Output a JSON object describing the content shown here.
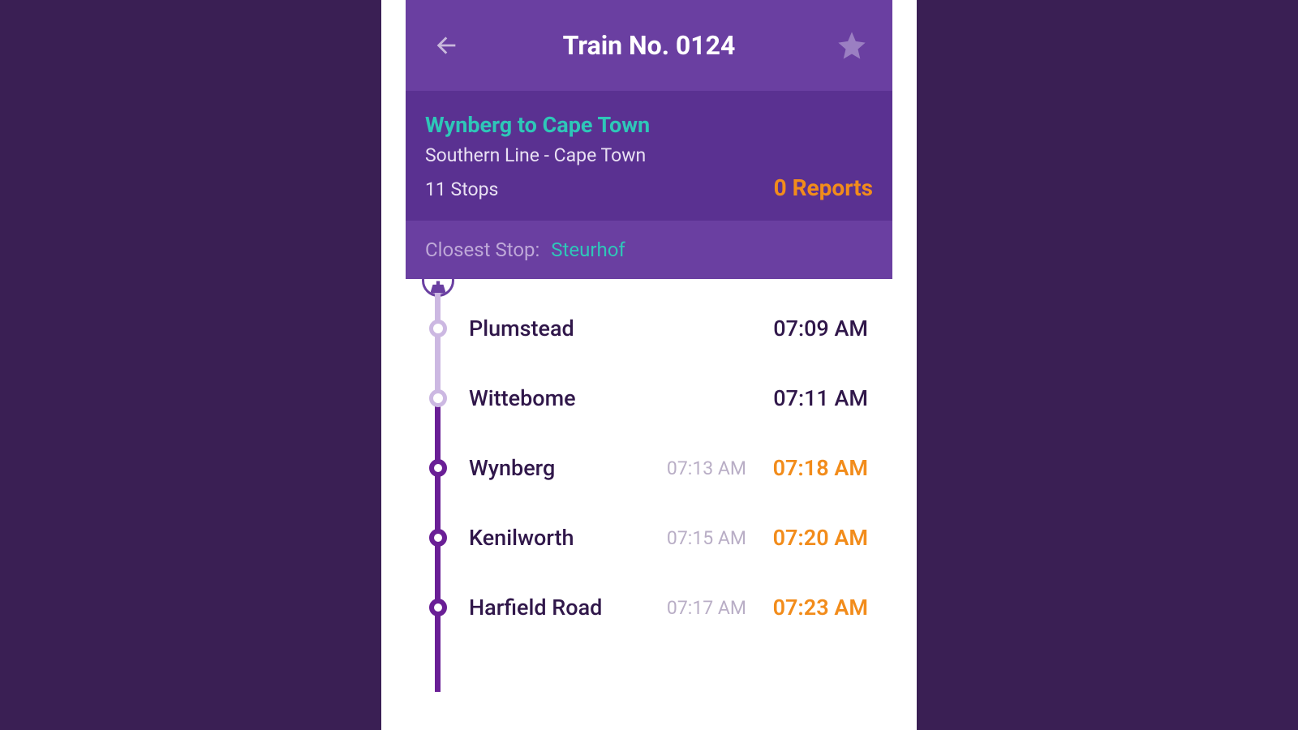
{
  "header": {
    "title": "Train No. 0124"
  },
  "summary": {
    "route": "Wynberg to Cape Town",
    "line": "Southern Line - Cape Town",
    "stops": "11 Stops",
    "reports": "0 Reports"
  },
  "closest": {
    "label": "Closest Stop:",
    "value": "Steurhof"
  },
  "stops": [
    {
      "name": "Plumstead",
      "scheduled": "",
      "time": "07:09 AM",
      "delayed": false
    },
    {
      "name": "Wittebome",
      "scheduled": "",
      "time": "07:11 AM",
      "delayed": false
    },
    {
      "name": "Wynberg",
      "scheduled": "07:13 AM",
      "time": "07:18 AM",
      "delayed": true
    },
    {
      "name": "Kenilworth",
      "scheduled": "07:15 AM",
      "time": "07:20 AM",
      "delayed": true
    },
    {
      "name": "Harfield Road",
      "scheduled": "07:17 AM",
      "time": "07:23 AM",
      "delayed": true
    }
  ],
  "colors": {
    "brand": "#6a3fa1",
    "dark_panel": "#5a3191",
    "teal": "#2ec7b8",
    "orange": "#f28c1b",
    "line_light": "#ccb8e2",
    "line_dark": "#6a1f96",
    "text_dark": "#30174a"
  },
  "icons": {
    "back": "arrow-left-icon",
    "star": "star-icon",
    "origin": "bell-icon"
  }
}
